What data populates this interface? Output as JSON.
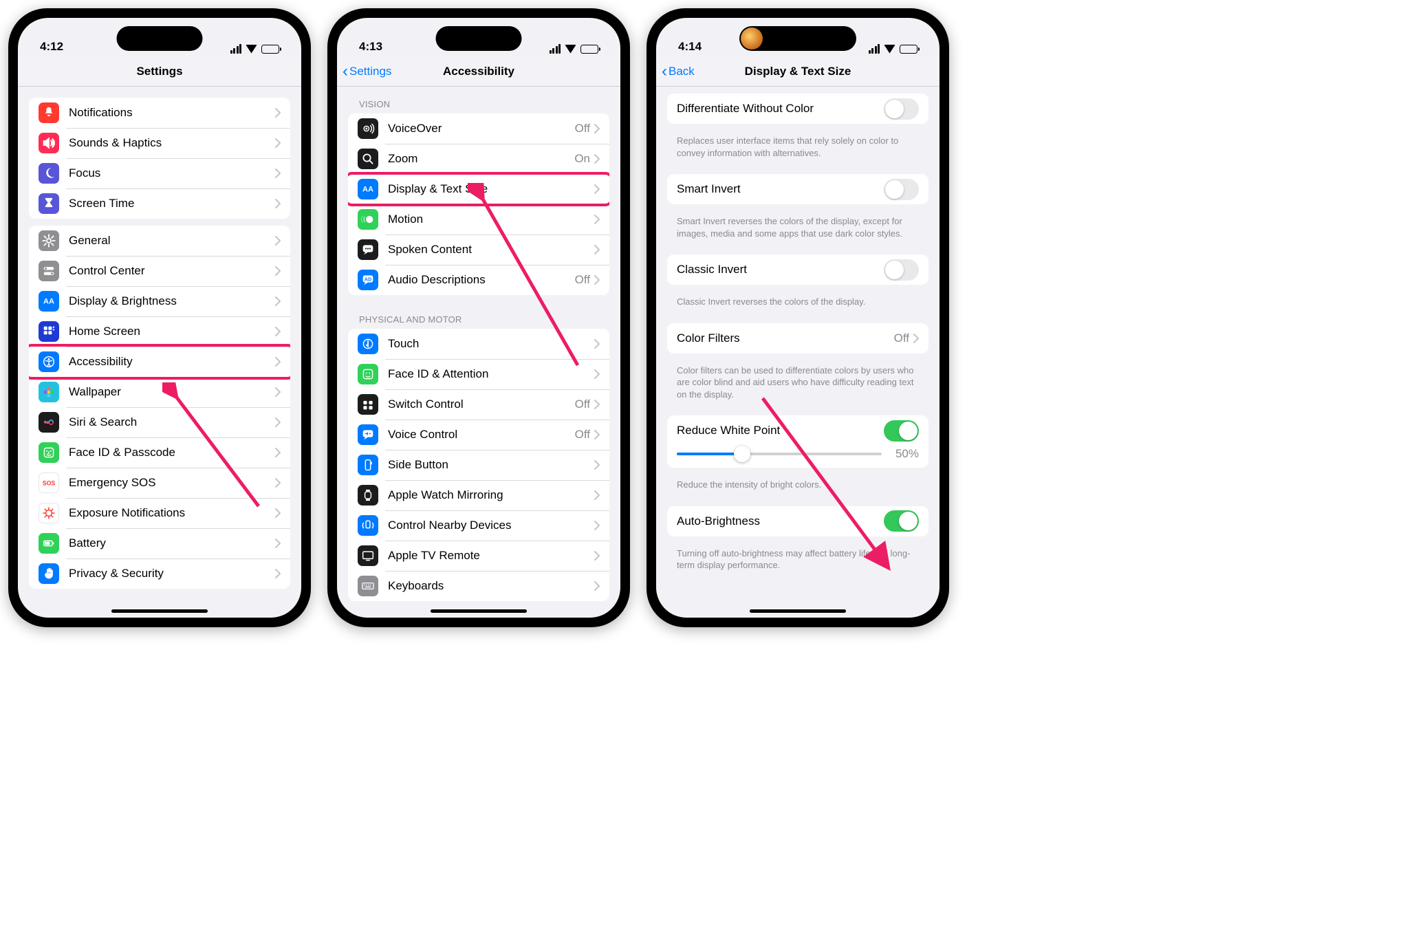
{
  "phone1": {
    "time": "4:12",
    "title": "Settings",
    "groups": [
      [
        {
          "icon": "bell",
          "color": "#ff3b30",
          "label": "Notifications"
        },
        {
          "icon": "speaker",
          "color": "#ff2d55",
          "label": "Sounds & Haptics"
        },
        {
          "icon": "moon",
          "color": "#5856d6",
          "label": "Focus"
        },
        {
          "icon": "hourglass",
          "color": "#5856d6",
          "label": "Screen Time"
        }
      ],
      [
        {
          "icon": "gear",
          "color": "#8e8e93",
          "label": "General"
        },
        {
          "icon": "switches",
          "color": "#8e8e93",
          "label": "Control Center"
        },
        {
          "icon": "AA",
          "color": "#007aff",
          "label": "Display & Brightness"
        },
        {
          "icon": "grid",
          "color": "#1e3ad5",
          "label": "Home Screen"
        },
        {
          "icon": "access",
          "color": "#007aff",
          "label": "Accessibility",
          "highlight": true
        },
        {
          "icon": "flower",
          "color": "#24c1de",
          "label": "Wallpaper"
        },
        {
          "icon": "siri",
          "color": "#1c1c1e",
          "label": "Siri & Search"
        },
        {
          "icon": "faceid",
          "color": "#30d158",
          "label": "Face ID & Passcode"
        },
        {
          "icon": "sos",
          "color": "#ffffff",
          "label": "Emergency SOS",
          "fg": "#ff3b30",
          "border": true
        },
        {
          "icon": "virus",
          "color": "#ffffff",
          "label": "Exposure Notifications",
          "fg": "#ff3b30",
          "border": true
        },
        {
          "icon": "battery",
          "color": "#30d158",
          "label": "Battery"
        },
        {
          "icon": "hand",
          "color": "#007aff",
          "label": "Privacy & Security"
        }
      ]
    ]
  },
  "phone2": {
    "time": "4:13",
    "back": "Settings",
    "title": "Accessibility",
    "sections": [
      {
        "header": "VISION",
        "rows": [
          {
            "icon": "voiceover",
            "color": "#1c1c1e",
            "label": "VoiceOver",
            "value": "Off"
          },
          {
            "icon": "zoom",
            "color": "#1c1c1e",
            "label": "Zoom",
            "value": "On"
          },
          {
            "icon": "AA",
            "color": "#007aff",
            "label": "Display & Text Size",
            "highlight": true
          },
          {
            "icon": "motion",
            "color": "#30d158",
            "label": "Motion"
          },
          {
            "icon": "speech",
            "color": "#1c1c1e",
            "label": "Spoken Content"
          },
          {
            "icon": "ad",
            "color": "#007aff",
            "label": "Audio Descriptions",
            "value": "Off"
          }
        ]
      },
      {
        "header": "PHYSICAL AND MOTOR",
        "rows": [
          {
            "icon": "touch",
            "color": "#007aff",
            "label": "Touch"
          },
          {
            "icon": "faceid2",
            "color": "#30d158",
            "label": "Face ID & Attention"
          },
          {
            "icon": "switch",
            "color": "#1c1c1e",
            "label": "Switch Control",
            "value": "Off"
          },
          {
            "icon": "voice",
            "color": "#007aff",
            "label": "Voice Control",
            "value": "Off"
          },
          {
            "icon": "side",
            "color": "#007aff",
            "label": "Side Button"
          },
          {
            "icon": "watch",
            "color": "#1c1c1e",
            "label": "Apple Watch Mirroring"
          },
          {
            "icon": "nearby",
            "color": "#007aff",
            "label": "Control Nearby Devices"
          },
          {
            "icon": "tv",
            "color": "#1c1c1e",
            "label": "Apple TV Remote"
          },
          {
            "icon": "kbd",
            "color": "#8e8e93",
            "label": "Keyboards"
          }
        ]
      }
    ]
  },
  "phone3": {
    "time": "4:14",
    "back": "Back",
    "title": "Display & Text Size",
    "items": [
      {
        "type": "toggle",
        "label": "Differentiate Without Color",
        "on": false,
        "footer": "Replaces user interface items that rely solely on color to convey information with alternatives."
      },
      {
        "type": "toggle",
        "label": "Smart Invert",
        "on": false,
        "footer": "Smart Invert reverses the colors of the display, except for images, media and some apps that use dark color styles."
      },
      {
        "type": "toggle",
        "label": "Classic Invert",
        "on": false,
        "footer": "Classic Invert reverses the colors of the display."
      },
      {
        "type": "nav",
        "label": "Color Filters",
        "value": "Off",
        "footer": "Color filters can be used to differentiate colors by users who are color blind and aid users who have difficulty reading text on the display."
      },
      {
        "type": "slider",
        "label": "Reduce White Point",
        "on": true,
        "sliderValue": "50%",
        "sliderPct": 32,
        "footer": "Reduce the intensity of bright colors."
      },
      {
        "type": "toggle",
        "label": "Auto-Brightness",
        "on": true,
        "highlight": true,
        "footer": "Turning off auto-brightness may affect battery life and long-term display performance."
      }
    ]
  }
}
